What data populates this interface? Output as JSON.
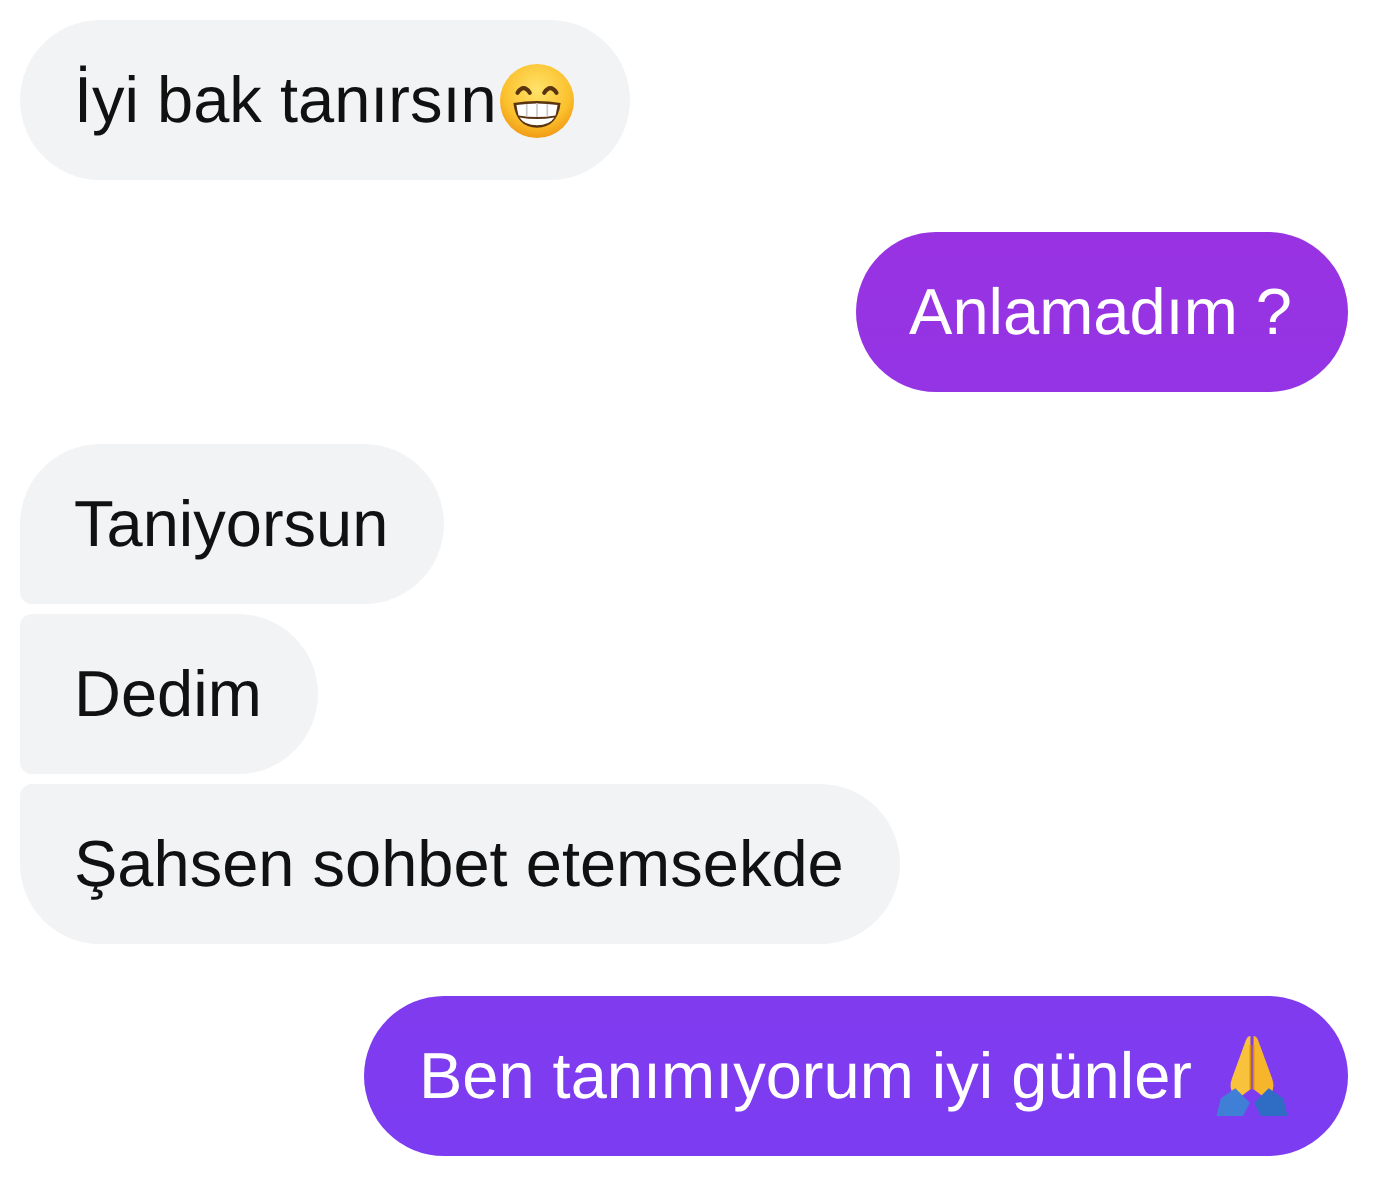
{
  "messages": [
    {
      "kind": "received",
      "text": "İyi bak tanırsın",
      "emoji": {
        "kind": "grinning"
      }
    },
    {
      "kind": "sent",
      "text": "Anlamadım ?"
    },
    {
      "kind": "received",
      "text": "Taniyorsun"
    },
    {
      "kind": "received",
      "text": "Dedim"
    },
    {
      "kind": "received",
      "text": "Şahsen sohbet etemsekde"
    },
    {
      "kind": "sent",
      "text": "Ben tanımıyorum iyi günler",
      "emoji": {
        "kind": "folded"
      }
    }
  ]
}
